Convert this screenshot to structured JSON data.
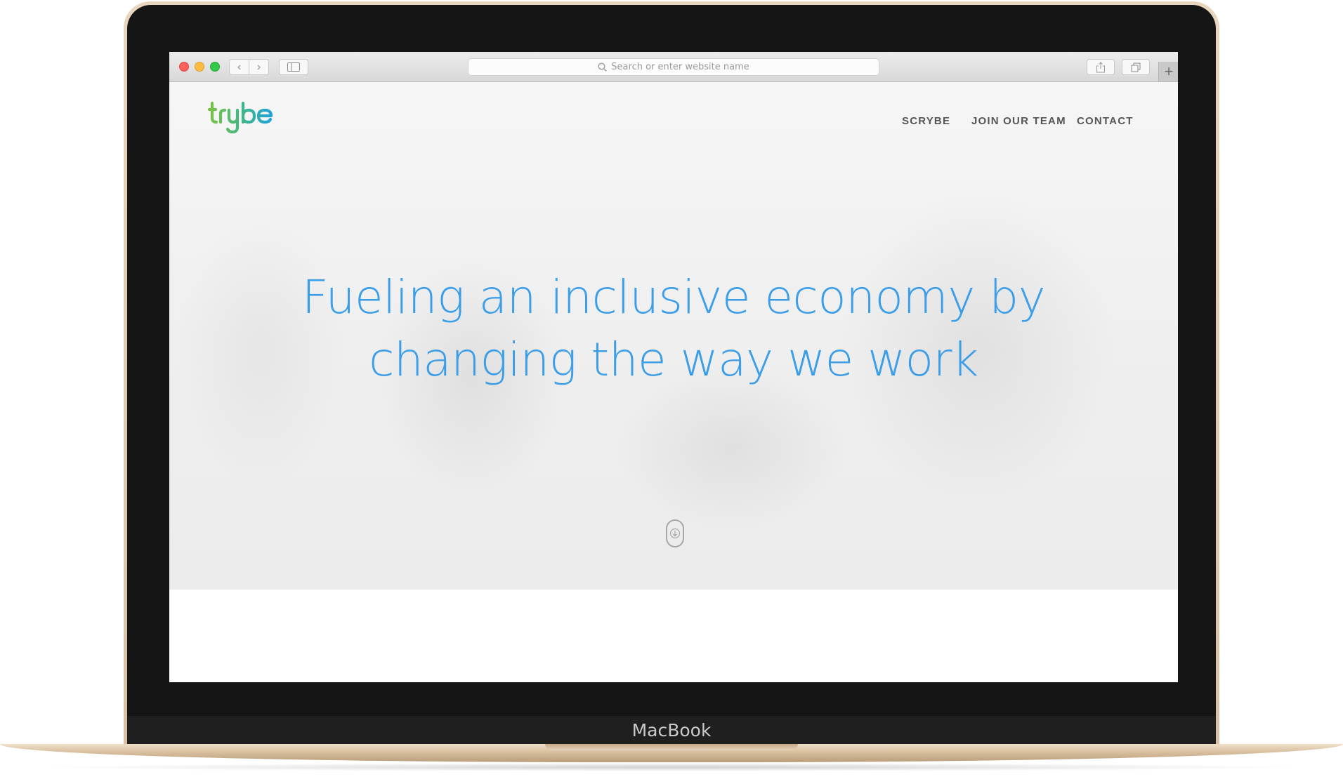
{
  "device": {
    "brand": "MacBook"
  },
  "browser": {
    "address_placeholder": "Search or enter website name",
    "back_glyph": "‹",
    "forward_glyph": "›",
    "newtab_glyph": "+"
  },
  "site": {
    "logo_text": "trybe",
    "nav": [
      "SCRYBE",
      "JOIN OUR TEAM",
      "CONTACT"
    ],
    "headline_line1": "Fueling an inclusive economy by",
    "headline_line2": "changing the way we work"
  },
  "colors": {
    "headline": "#3d9ee8",
    "logo_green": "#7ac143",
    "logo_blue": "#1fa3d8"
  },
  "icons": [
    "search-icon",
    "sidebar-icon",
    "share-icon",
    "tabs-icon",
    "scroll-down-icon"
  ]
}
